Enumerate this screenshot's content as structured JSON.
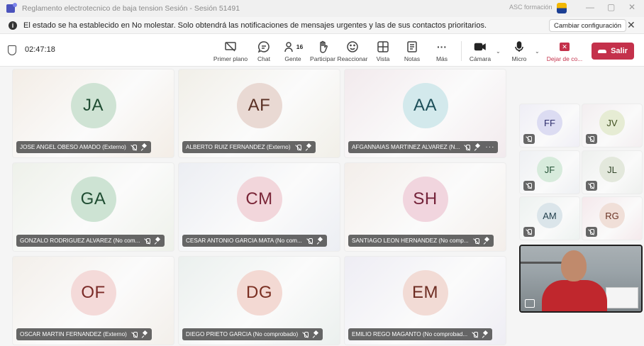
{
  "window": {
    "title": "Reglamento electrotecnico de baja tension Sesión - Sesión 51491",
    "account": "ASC formación",
    "controls": {
      "minimize": "—",
      "maximize": "▢",
      "close": "✕"
    }
  },
  "notice": {
    "text": "El estado se ha establecido en No molestar. Solo obtendrá las notificaciones de mensajes urgentes y las de sus contactos prioritarios.",
    "button": "Cambiar configuración",
    "close": "✕"
  },
  "toolbar": {
    "timer": "02:47:18",
    "items": [
      {
        "label": "Primer plano",
        "icon": "focus-icon"
      },
      {
        "label": "Chat",
        "icon": "chat-icon"
      },
      {
        "label": "Gente",
        "icon": "people-icon",
        "count": "16"
      },
      {
        "label": "Participar",
        "icon": "raise-hand-icon"
      },
      {
        "label": "Reaccionar",
        "icon": "smiley-icon"
      },
      {
        "label": "Vista",
        "icon": "grid-icon"
      },
      {
        "label": "Notas",
        "icon": "notes-icon"
      },
      {
        "label": "Más",
        "icon": "more-icon",
        "glyph": "···"
      },
      {
        "label": "Cámara",
        "icon": "camera-icon"
      },
      {
        "label": "Micro",
        "icon": "mic-icon"
      },
      {
        "label": "Dejar de co...",
        "icon": "stop-share-icon",
        "glyph": "✕"
      }
    ],
    "leave": "Salir"
  },
  "participants": [
    {
      "initials": "JA",
      "name": "JOSE ANGEL OBESO AMADO (Externo)",
      "avatar_bg": "#cfe3d4",
      "avatar_fg": "#1f4d32",
      "tile_bg": "#f3ede6"
    },
    {
      "initials": "AF",
      "name": "ALBERTO RUIZ FERNANDEZ (Externo)",
      "avatar_bg": "#e9d9d3",
      "avatar_fg": "#5a3024",
      "tile_bg": "#f1efe8"
    },
    {
      "initials": "AA",
      "name": "AFGANNAIAS MARTINEZ ALVAREZ (N...",
      "avatar_bg": "#d3e9ec",
      "avatar_fg": "#1d4f59",
      "tile_bg": "#f2eaed",
      "more": "···"
    },
    {
      "initials": "GA",
      "name": "GONZALO RODRIGUEZ ALVAREZ (No com...",
      "avatar_bg": "#cde3d3",
      "avatar_fg": "#1f4d32",
      "tile_bg": "#eef1ea"
    },
    {
      "initials": "CM",
      "name": "CESAR ANTONIO GARCIA MATA (No com...",
      "avatar_bg": "#f2d6db",
      "avatar_fg": "#7a2638",
      "tile_bg": "#eceef3"
    },
    {
      "initials": "SH",
      "name": "SANTIAGO LEON HERNANDEZ (No comp...",
      "avatar_bg": "#f1d5de",
      "avatar_fg": "#74233a",
      "tile_bg": "#f3eeea"
    },
    {
      "initials": "OF",
      "name": "OSCAR MARTIN FERNANDEZ (Externo)",
      "avatar_bg": "#f4dad9",
      "avatar_fg": "#7a2a27",
      "tile_bg": "#f3efea"
    },
    {
      "initials": "DG",
      "name": "DIEGO PRIETO GARCIA (No comprobado)",
      "avatar_bg": "#f3d9d3",
      "avatar_fg": "#7a2f22",
      "tile_bg": "#ebf0ee"
    },
    {
      "initials": "EM",
      "name": "EMILIO REGO MAGANTO (No comprobad...",
      "avatar_bg": "#f2dbd5",
      "avatar_fg": "#6d2c22",
      "tile_bg": "#eeedf4"
    }
  ],
  "side_participants": [
    {
      "initials": "FF",
      "avatar_bg": "#dcdcf2",
      "avatar_fg": "#2f2f6d",
      "tile_bg": "#efeef6"
    },
    {
      "initials": "JV",
      "avatar_bg": "#e6ecd4",
      "avatar_fg": "#3f4f1f",
      "tile_bg": "#f3eef0"
    },
    {
      "initials": "JF",
      "avatar_bg": "#d7ebdc",
      "avatar_fg": "#245236",
      "tile_bg": "#eef0f3"
    },
    {
      "initials": "JL",
      "avatar_bg": "#e3e8dc",
      "avatar_fg": "#33462a",
      "tile_bg": "#eef0ee"
    },
    {
      "initials": "AM",
      "avatar_bg": "#dbe5ea",
      "avatar_fg": "#23404d",
      "tile_bg": "#edf2f0"
    },
    {
      "initials": "RG",
      "avatar_bg": "#f0dfd8",
      "avatar_fg": "#6a3324",
      "tile_bg": "#f5e9ec"
    }
  ]
}
